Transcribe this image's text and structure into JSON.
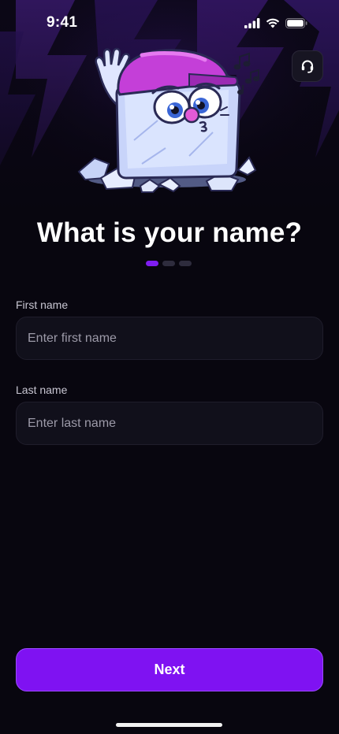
{
  "status_bar": {
    "time": "9:41"
  },
  "header": {
    "support_icon": "headset-icon",
    "mascot_icon": "ice-cube-mascot-icon"
  },
  "title": "What is your name?",
  "progress": {
    "total_steps": 3,
    "current_step": 1
  },
  "form": {
    "first_name": {
      "label": "First name",
      "placeholder": "Enter first name",
      "value": ""
    },
    "last_name": {
      "label": "Last name",
      "placeholder": "Enter last name",
      "value": ""
    }
  },
  "next_button": {
    "label": "Next"
  },
  "colors": {
    "background": "#08060f",
    "accent": "#7f12f2",
    "field_background": "#11101b"
  }
}
